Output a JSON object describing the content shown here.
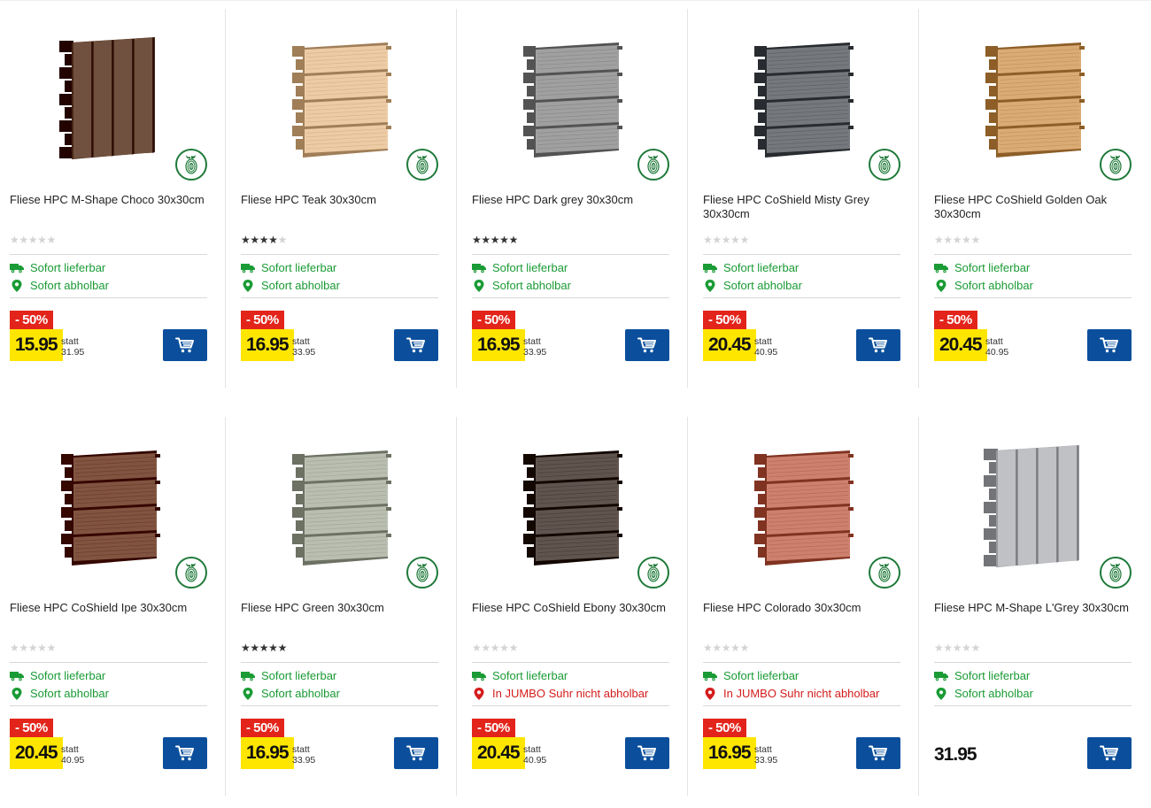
{
  "products": [
    {
      "title": "Fliese HPC M-Shape Choco 30x30cm",
      "rating": 0,
      "avail1": "Sofort lieferbar",
      "avail2": "Sofort abholbar",
      "avail2_ok": true,
      "discount": "- 50%",
      "price": "15.95",
      "statt_label": "statt",
      "old_price": "31.95",
      "tile": "mshape",
      "color": "#5a3a28"
    },
    {
      "title": "Fliese HPC Teak 30x30cm",
      "rating": 4,
      "avail1": "Sofort lieferbar",
      "avail2": "Sofort abholbar",
      "avail2_ok": true,
      "discount": "- 50%",
      "price": "16.95",
      "statt_label": "statt",
      "old_price": "33.95",
      "tile": "plank",
      "color": "#d7b58e"
    },
    {
      "title": "Fliese HPC Dark grey 30x30cm",
      "rating": 5,
      "avail1": "Sofort lieferbar",
      "avail2": "Sofort abholbar",
      "avail2_ok": true,
      "discount": "- 50%",
      "price": "16.95",
      "statt_label": "statt",
      "old_price": "33.95",
      "tile": "plank",
      "color": "#8a8a8a"
    },
    {
      "title": "Fliese HPC CoShield Misty Grey 30x30cm",
      "rating": 0,
      "avail1": "Sofort lieferbar",
      "avail2": "Sofort abholbar",
      "avail2_ok": true,
      "discount": "- 50%",
      "price": "20.45",
      "statt_label": "statt",
      "old_price": "40.95",
      "tile": "plank",
      "color": "#5f6266"
    },
    {
      "title": "Fliese HPC CoShield Golden Oak 30x30cm",
      "rating": 0,
      "avail1": "Sofort lieferbar",
      "avail2": "Sofort abholbar",
      "avail2_ok": true,
      "discount": "- 50%",
      "price": "20.45",
      "statt_label": "statt",
      "old_price": "40.95",
      "tile": "plank",
      "color": "#c4955e"
    },
    {
      "title": "Fliese HPC CoShield Ipe 30x30cm",
      "rating": 0,
      "avail1": "Sofort lieferbar",
      "avail2": "Sofort abholbar",
      "avail2_ok": true,
      "discount": "- 50%",
      "price": "20.45",
      "statt_label": "statt",
      "old_price": "40.95",
      "tile": "plank",
      "color": "#6b3e2b"
    },
    {
      "title": "Fliese HPC Green 30x30cm",
      "rating": 5,
      "avail1": "Sofort lieferbar",
      "avail2": "Sofort abholbar",
      "avail2_ok": true,
      "discount": "- 50%",
      "price": "16.95",
      "statt_label": "statt",
      "old_price": "33.95",
      "tile": "plank",
      "color": "#a3a89a"
    },
    {
      "title": "Fliese HPC CoShield Ebony 30x30cm",
      "rating": 0,
      "avail1": "Sofort lieferbar",
      "avail2": "In JUMBO Suhr nicht abholbar",
      "avail2_ok": false,
      "discount": "- 50%",
      "price": "20.45",
      "statt_label": "statt",
      "old_price": "40.95",
      "tile": "plank",
      "color": "#4a3f38"
    },
    {
      "title": "Fliese HPC Colorado 30x30cm",
      "rating": 0,
      "avail1": "Sofort lieferbar",
      "avail2": "In JUMBO Suhr nicht abholbar",
      "avail2_ok": false,
      "discount": "- 50%",
      "price": "16.95",
      "statt_label": "statt",
      "old_price": "33.95",
      "tile": "plank",
      "color": "#b86a58"
    },
    {
      "title": "Fliese HPC M-Shape L'Grey 30x30cm",
      "rating": 0,
      "avail1": "Sofort lieferbar",
      "avail2": "Sofort abholbar",
      "avail2_ok": true,
      "discount": "",
      "price": "31.95",
      "statt_label": "",
      "old_price": "",
      "tile": "mshape",
      "color": "#a9abae"
    }
  ],
  "colors": {
    "accent_blue": "#0b4f9c",
    "discount_red": "#e3241b",
    "price_yellow": "#ffe600",
    "available_green": "#1a9b35",
    "unavailable_red": "#d41c1c"
  },
  "icons": {
    "eco_badge": "fingerprint-leaf-icon",
    "delivery": "truck-icon",
    "pickup": "map-pin-icon",
    "cart": "shopping-cart-icon"
  }
}
